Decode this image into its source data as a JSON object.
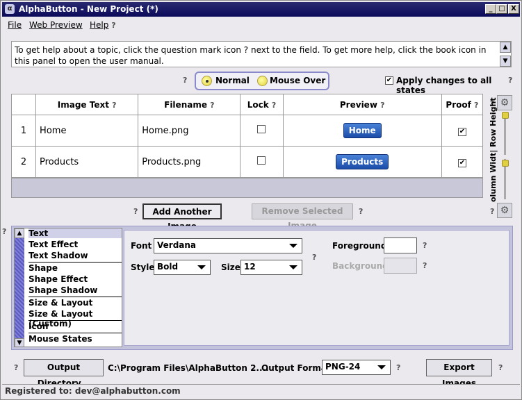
{
  "window": {
    "title": "AlphaButton - New Project (*)",
    "controls": [
      "_",
      "□",
      "X"
    ]
  },
  "menu": {
    "file": "File",
    "web_preview": "Web Preview",
    "help": "Help",
    "help_q": "?"
  },
  "help_panel": {
    "text": "To get help about a topic, click the question mark icon ? next to the field. To get more help, click the book icon in this panel to open the user manual."
  },
  "states": {
    "q": "?",
    "normal": "Normal",
    "mouse_over": "Mouse Over",
    "apply_all": "Apply changes to all states",
    "apply_all_checked": true
  },
  "table": {
    "headers": {
      "image_text": "Image Text",
      "filename": "Filename",
      "lock": "Lock",
      "preview": "Preview",
      "proof": "Proof"
    },
    "rows": [
      {
        "num": "1",
        "text": "Home",
        "filename": "Home.png",
        "lock": false,
        "preview": "Home",
        "proof": true
      },
      {
        "num": "2",
        "text": "Products",
        "filename": "Products.png",
        "lock": false,
        "preview": "Products",
        "proof": true
      }
    ],
    "side_label": "olumn Widt| Row Height"
  },
  "actions": {
    "add_image": "Add Another Image",
    "remove_image": "Remove Selected Image"
  },
  "categories": [
    "Text",
    "Text Effect",
    "Text Shadow",
    "Shape",
    "Shape Effect",
    "Shape Shadow",
    "Size & Layout",
    "Size & Layout (Custom)",
    "Icon",
    "Mouse States"
  ],
  "props": {
    "font_label": "Font",
    "font_value": "Verdana",
    "style_label": "Style",
    "style_value": "Bold",
    "size_label": "Size",
    "size_value": "12",
    "foreground_label": "Foreground",
    "background_label": "Background"
  },
  "output": {
    "dir_button": "Output Directory...",
    "dir_path": "C:\\Program Files\\AlphaButton 2....",
    "format_label": "Output Format:",
    "format_value": "PNG-24",
    "export_button": "Export Images"
  },
  "status": {
    "text": "Registered to: dev@alphabutton.com"
  }
}
